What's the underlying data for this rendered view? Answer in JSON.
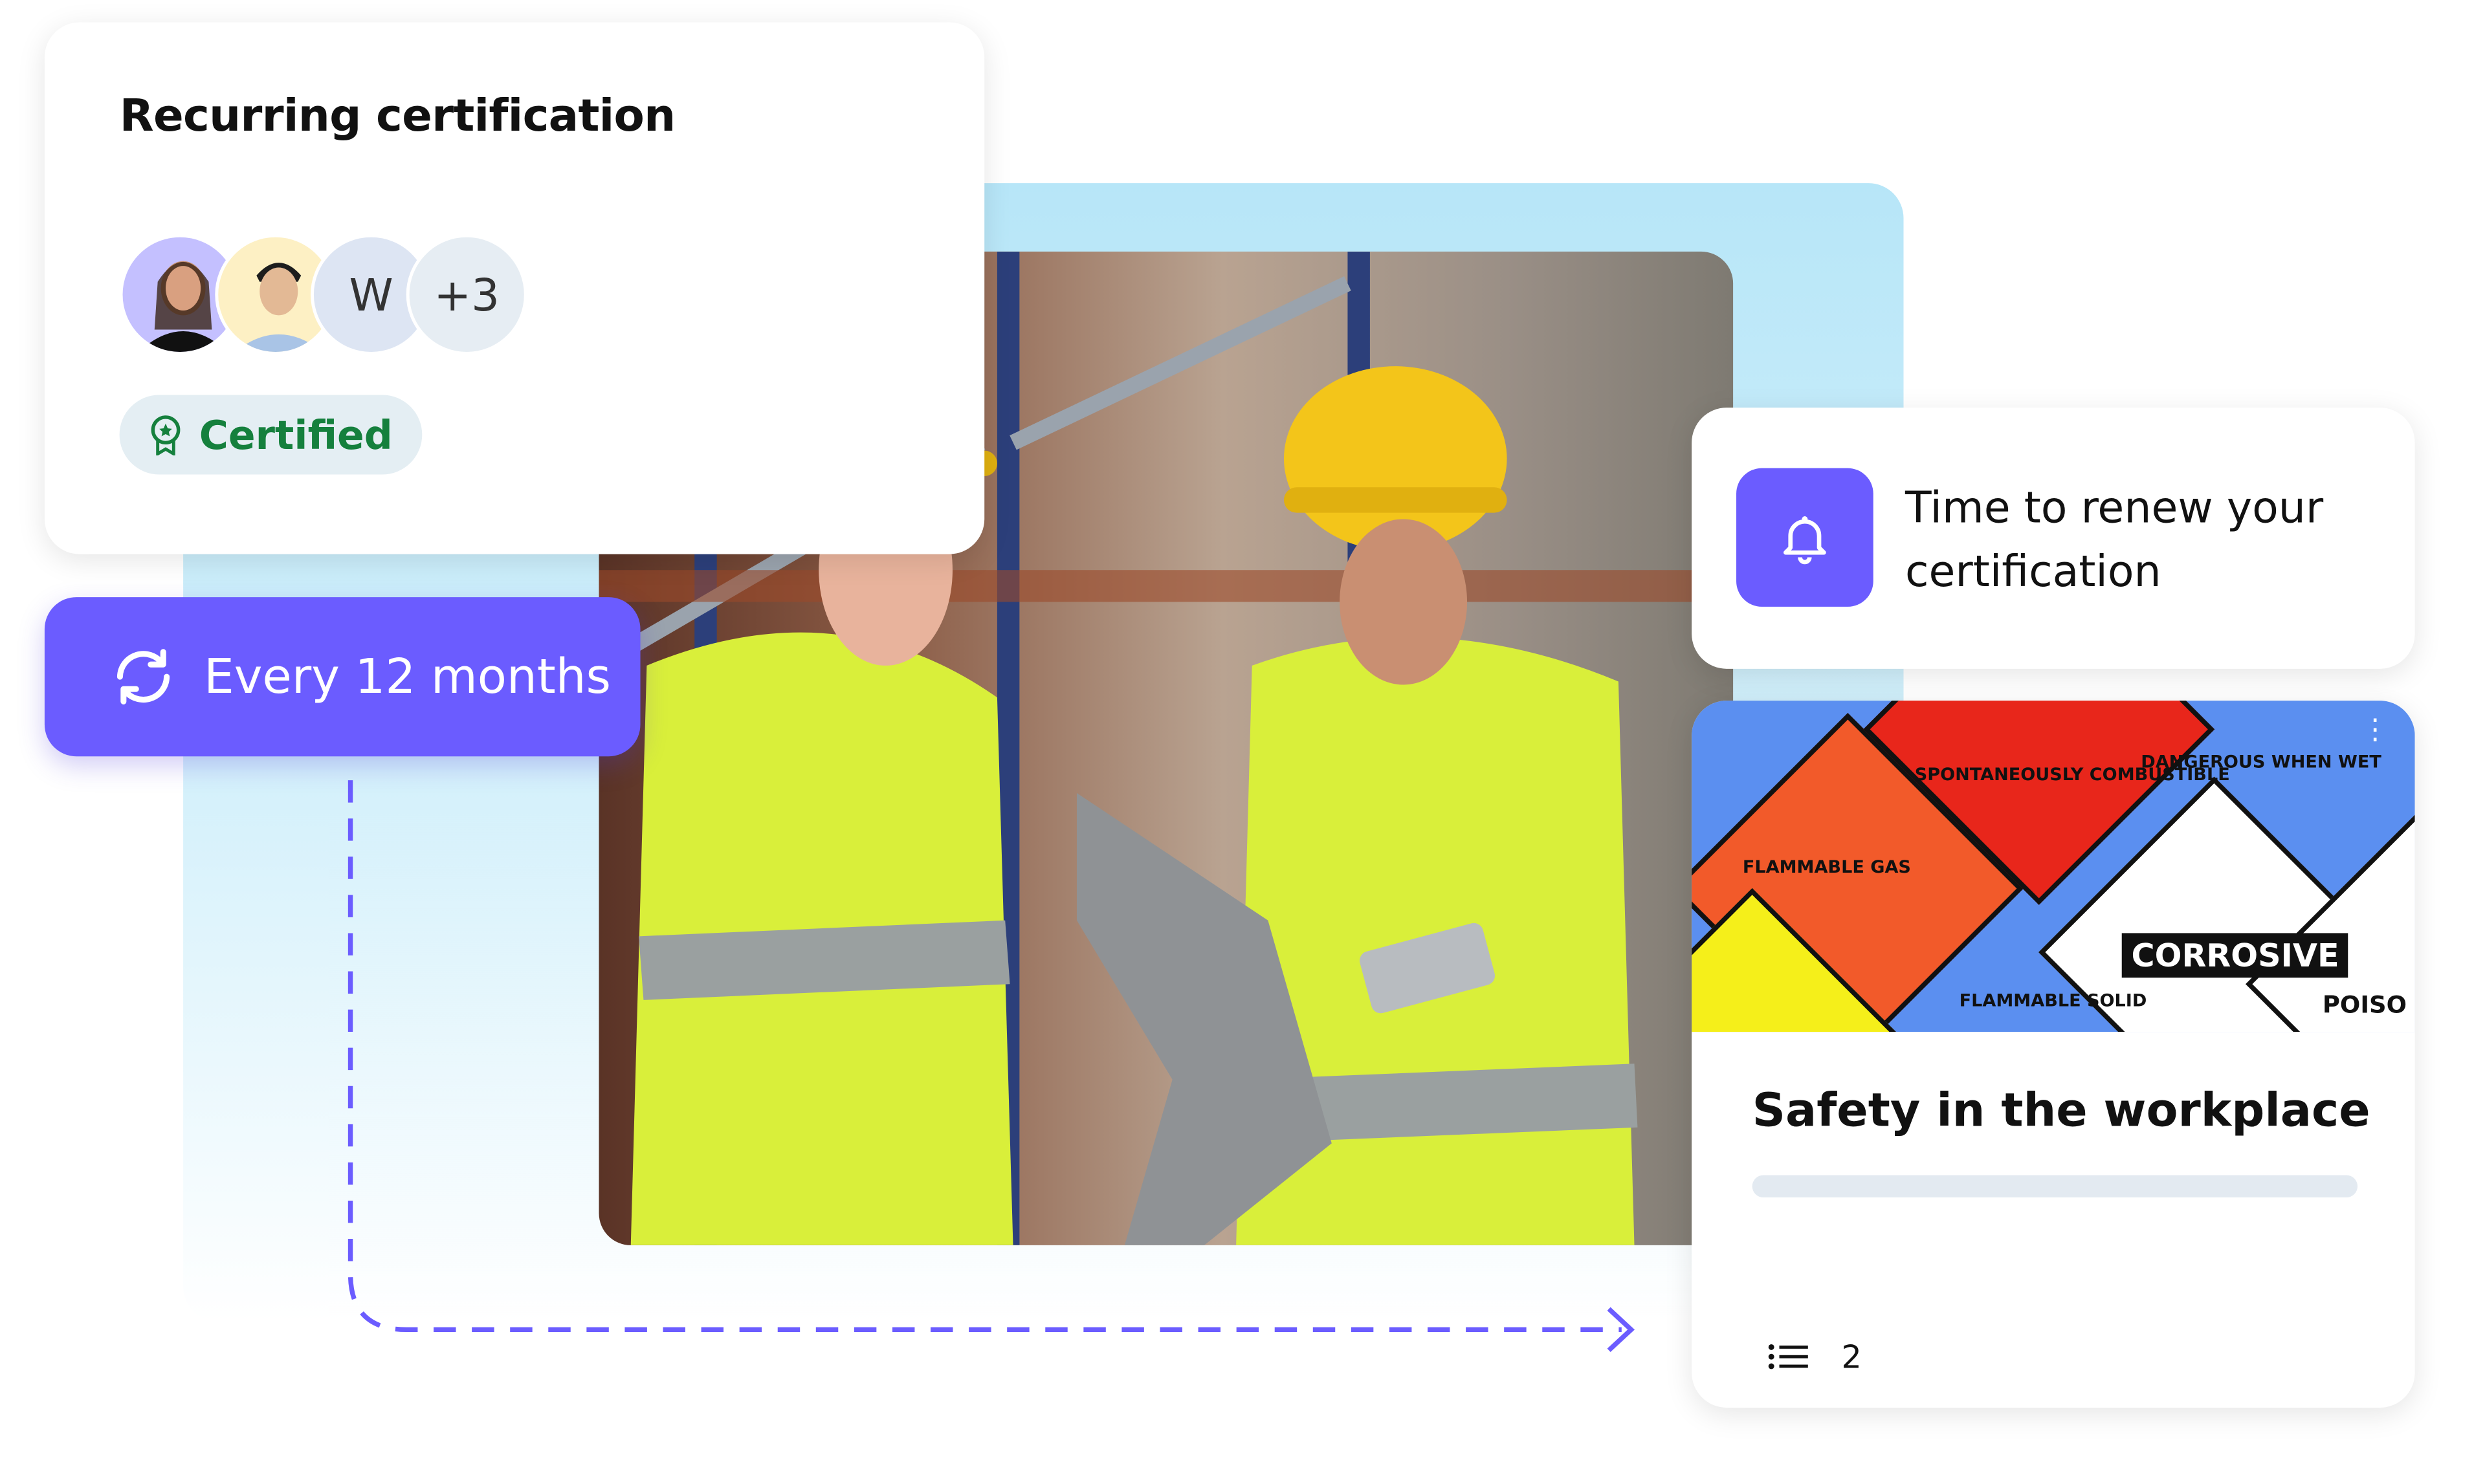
{
  "certification_card": {
    "title": "Recurring certification",
    "avatars": [
      {
        "type": "photo",
        "bg": "#c4c0ff"
      },
      {
        "type": "photo",
        "bg": "#fdf0c4"
      },
      {
        "type": "initial",
        "label": "W",
        "bg": "#dde5f3"
      },
      {
        "type": "overflow",
        "label": "+3",
        "bg": "#e6edf3"
      }
    ],
    "status_badge": {
      "label": "Certified",
      "icon": "award-icon",
      "color": "#15803d"
    }
  },
  "recurrence_button": {
    "label": "Every 12 months",
    "icon": "refresh-icon",
    "color": "#6b5cff"
  },
  "notification": {
    "icon": "bell-icon",
    "text_line1": "Time to renew your",
    "text_line2": "certification"
  },
  "course_card": {
    "image_labels": [
      "SPONTANEOUSLY COMBUSTIBLE",
      "FLAMMABLE GAS",
      "DANGEROUS WHEN WET",
      "CORROSIVE",
      "FLAMMABLE SOLID",
      "POISO"
    ],
    "title": "Safety in the workplace",
    "progress": 0,
    "lessons_icon": "list-icon",
    "lessons_count": "2"
  },
  "colors": {
    "accent": "#6b5cff",
    "panel": "#b7e6f8",
    "success": "#15803d"
  }
}
